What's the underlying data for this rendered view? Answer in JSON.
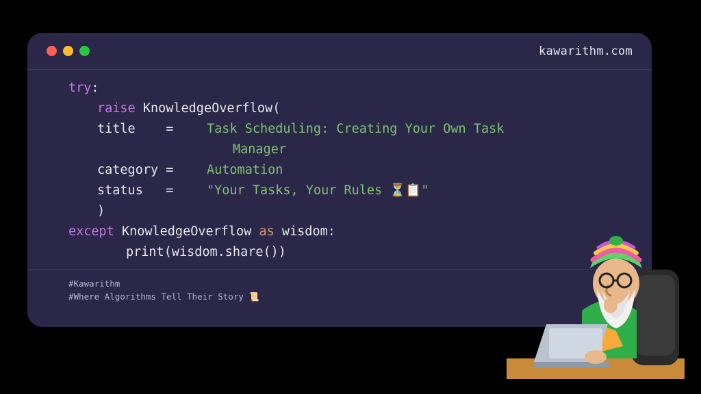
{
  "window": {
    "domain": "kawarithm.com"
  },
  "code": {
    "try": "try",
    "colon": ":",
    "raise": "raise",
    "class_name": "KnowledgeOverflow",
    "open_paren": "(",
    "title_label": "title    = ",
    "title_value": "Task Scheduling: Creating Your Own Task",
    "title_value2": "Manager",
    "category_label": "category = ",
    "category_value": "Automation",
    "status_label": "status   = ",
    "status_value": "\"Your Tasks, Your Rules ⏳📋\"",
    "close_paren": ")",
    "except": "except",
    "as": "as",
    "wisdom": "wisdom",
    "print_line": "print(wisdom.share())"
  },
  "footer": {
    "tag1": "#Kawarithm",
    "tag2": "#Where Algorithms Tell Their Story 📜"
  },
  "colors": {
    "bg": "#000000",
    "card": "#2a2749",
    "keyword": "#c678dd",
    "string": "#7fc36f",
    "operator": "#d19a66",
    "text": "#e9e7f0"
  }
}
